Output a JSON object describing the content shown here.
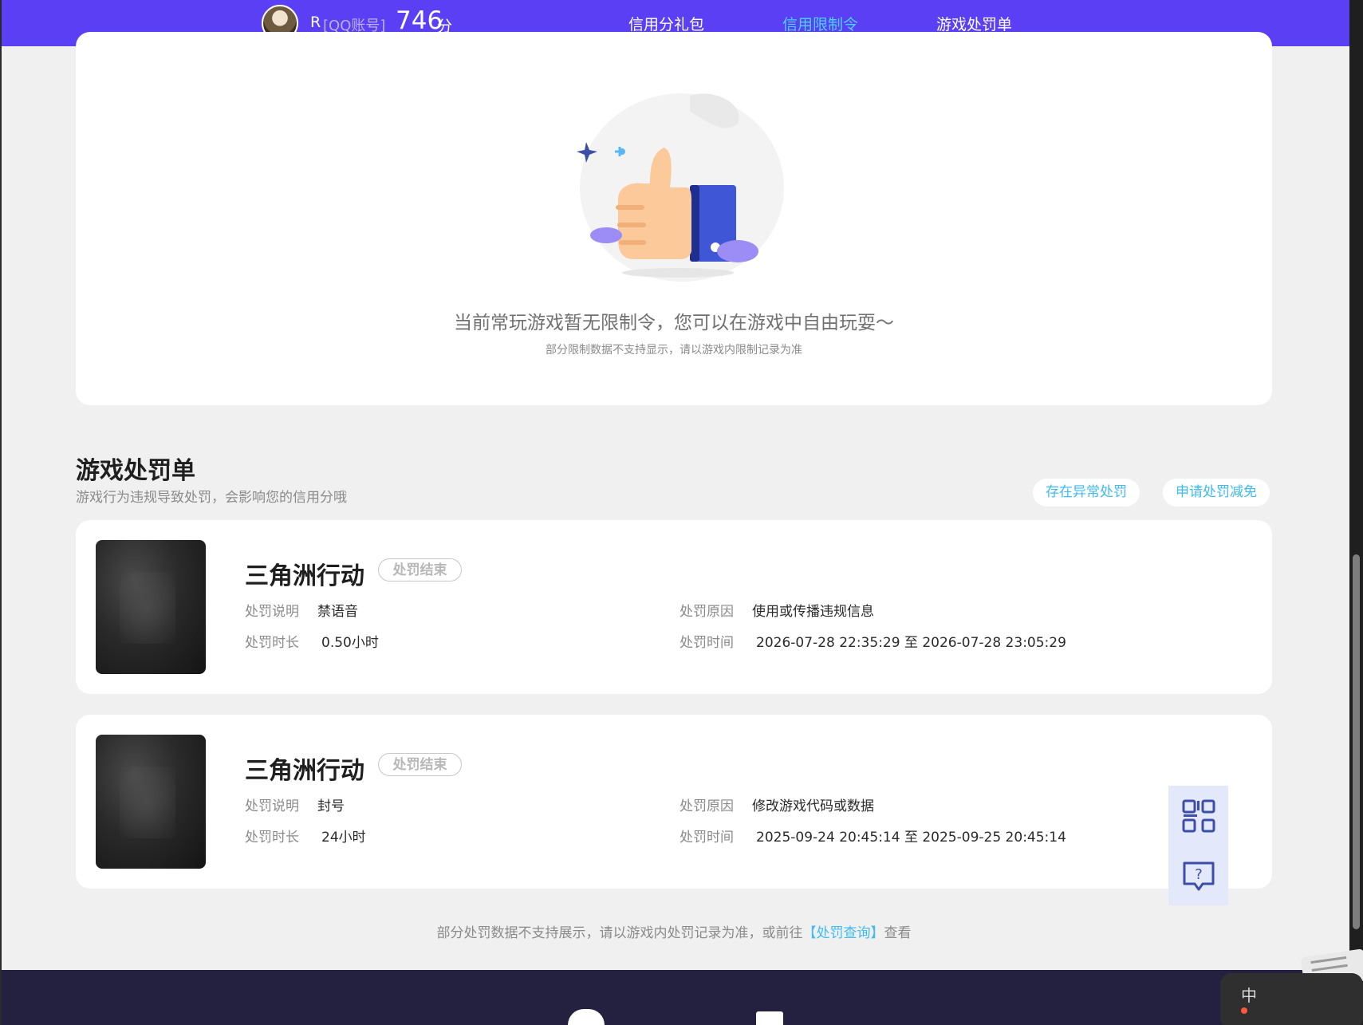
{
  "header": {
    "user_name": "R",
    "account_type": "[QQ账号]",
    "score": "746",
    "score_unit": "分",
    "tabs": [
      {
        "label": "信用分礼包",
        "active": false
      },
      {
        "label": "信用限制令",
        "active": true
      },
      {
        "label": "游戏处罚单",
        "active": false
      }
    ]
  },
  "restriction": {
    "empty_message": "当前常玩游戏暂无限制令，您可以在游戏中自由玩耍～",
    "empty_sub": "部分限制数据不支持显示，请以游戏内限制记录为准"
  },
  "penalty_section": {
    "title": "游戏处罚单",
    "subtitle": "游戏行为违规导致处罚，会影响您的信用分哦",
    "btn_abnormal": "存在异常处罚",
    "btn_appeal": "申请处罚减免"
  },
  "labels": {
    "desc": "处罚说明",
    "duration": "处罚时长",
    "reason": "处罚原因",
    "time": "处罚时间"
  },
  "penalties": [
    {
      "game": "三角洲行动",
      "status": "处罚结束",
      "desc": "禁语音",
      "duration": "0.50小时",
      "reason": "使用或传播违规信息",
      "time": "2026-07-28 22:35:29 至 2026-07-28 23:05:29"
    },
    {
      "game": "三角洲行动",
      "status": "处罚结束",
      "desc": "封号",
      "duration": "24小时",
      "reason": "修改游戏代码或数据",
      "time": "2025-09-24 20:45:14 至 2025-09-25 20:45:14"
    }
  ],
  "footer_note": {
    "before": "部分处罚数据不支持展示，请以游戏内处罚记录为准，或前往",
    "link": "【处罚查询】",
    "after": "查看"
  },
  "ime": {
    "label": "中"
  },
  "colors": {
    "header_bg": "#5a3ff5",
    "accent": "#49d3ff",
    "link": "#3dbbf2",
    "page_bg": "#f0f0f0",
    "footer_bg": "#24203f"
  },
  "icons": [
    "avatar",
    "thumbs-up-illustration",
    "game-cover",
    "qrcode-icon",
    "help-chat-icon",
    "wechat-icon",
    "ime-icon"
  ]
}
